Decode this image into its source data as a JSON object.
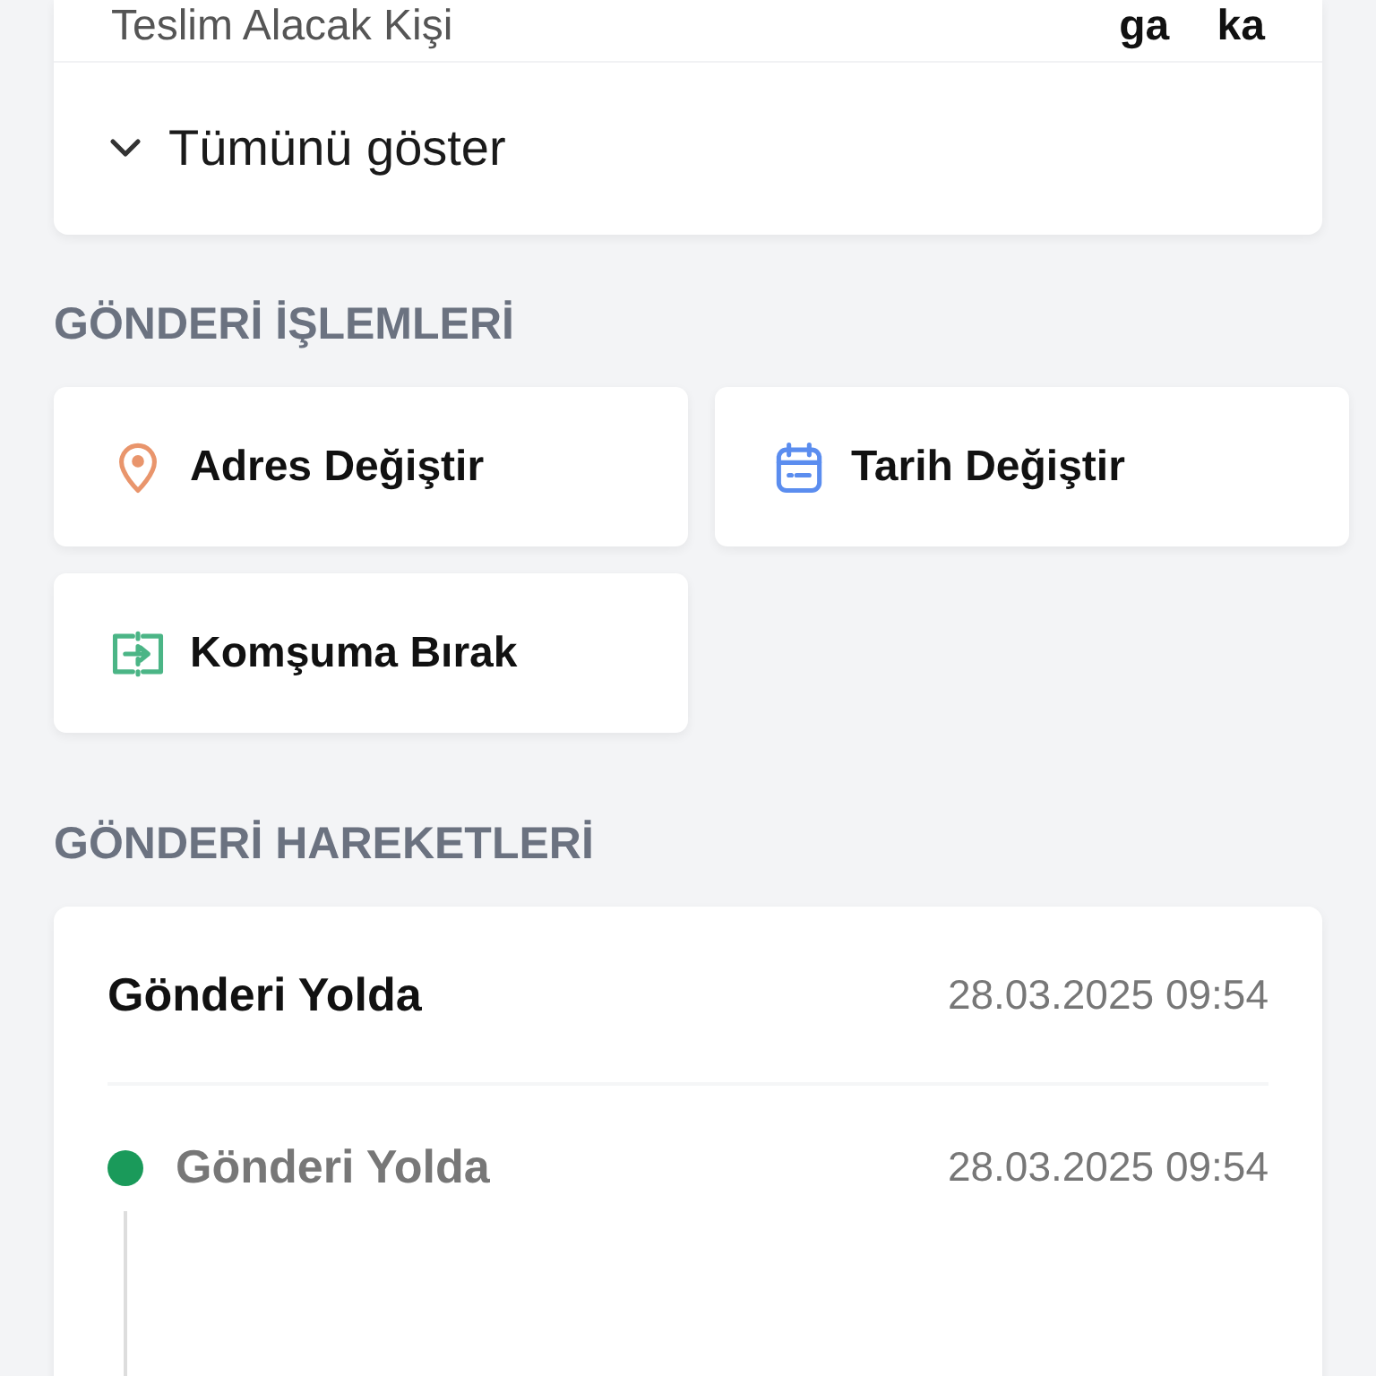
{
  "recipient": {
    "label": "Teslim Alacak Kişi",
    "value": "ga    ka"
  },
  "show_all": {
    "label": "Tümünü göster",
    "expanded": false
  },
  "actions_section": {
    "title": "GÖNDERİ İŞLEMLERİ",
    "actions": [
      {
        "label": "Adres Değiştir",
        "kind": "pin",
        "color": "#e9956c"
      },
      {
        "label": "Tarih Değiştir",
        "kind": "calendar",
        "color": "#5b8def"
      },
      {
        "label": "Komşuma Bırak",
        "kind": "transfer",
        "color": "#4bb586"
      }
    ]
  },
  "movements_section": {
    "title": "GÖNDERİ HAREKETLERİ",
    "current": {
      "status": "Gönderi Yolda",
      "time": "28.03.2025 09:54"
    },
    "events": [
      {
        "status": "Gönderi Yolda",
        "time": "28.03.2025 09:54",
        "color": "#1a9a5a"
      }
    ]
  }
}
